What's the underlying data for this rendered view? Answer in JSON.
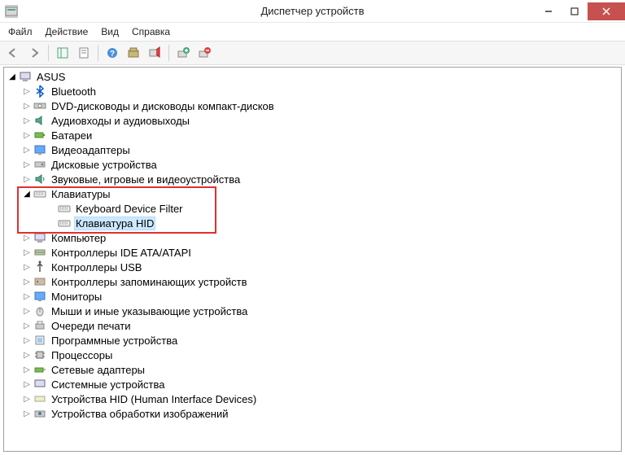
{
  "window": {
    "title": "Диспетчер устройств"
  },
  "menu": {
    "file": "Файл",
    "action": "Действие",
    "view": "Вид",
    "help": "Справка"
  },
  "tree": {
    "root": "ASUS",
    "n0": "Bluetooth",
    "n1": "DVD-дисководы и дисководы компакт-дисков",
    "n2": "Аудиовходы и аудиовыходы",
    "n3": "Батареи",
    "n4": "Видеоадаптеры",
    "n5": "Дисковые устройства",
    "n6": "Звуковые, игровые и видеоустройства",
    "n7": "Клавиатуры",
    "n7a": "Keyboard Device Filter",
    "n7b": "Клавиатура HID",
    "n8": "Компьютер",
    "n9": "Контроллеры IDE ATA/ATAPI",
    "n10": "Контроллеры USB",
    "n11": "Контроллеры запоминающих устройств",
    "n12": "Мониторы",
    "n13": "Мыши и иные указывающие устройства",
    "n14": "Очереди печати",
    "n15": "Программные устройства",
    "n16": "Процессоры",
    "n17": "Сетевые адаптеры",
    "n18": "Системные устройства",
    "n19": "Устройства HID (Human Interface Devices)",
    "n20": "Устройства обработки изображений"
  }
}
